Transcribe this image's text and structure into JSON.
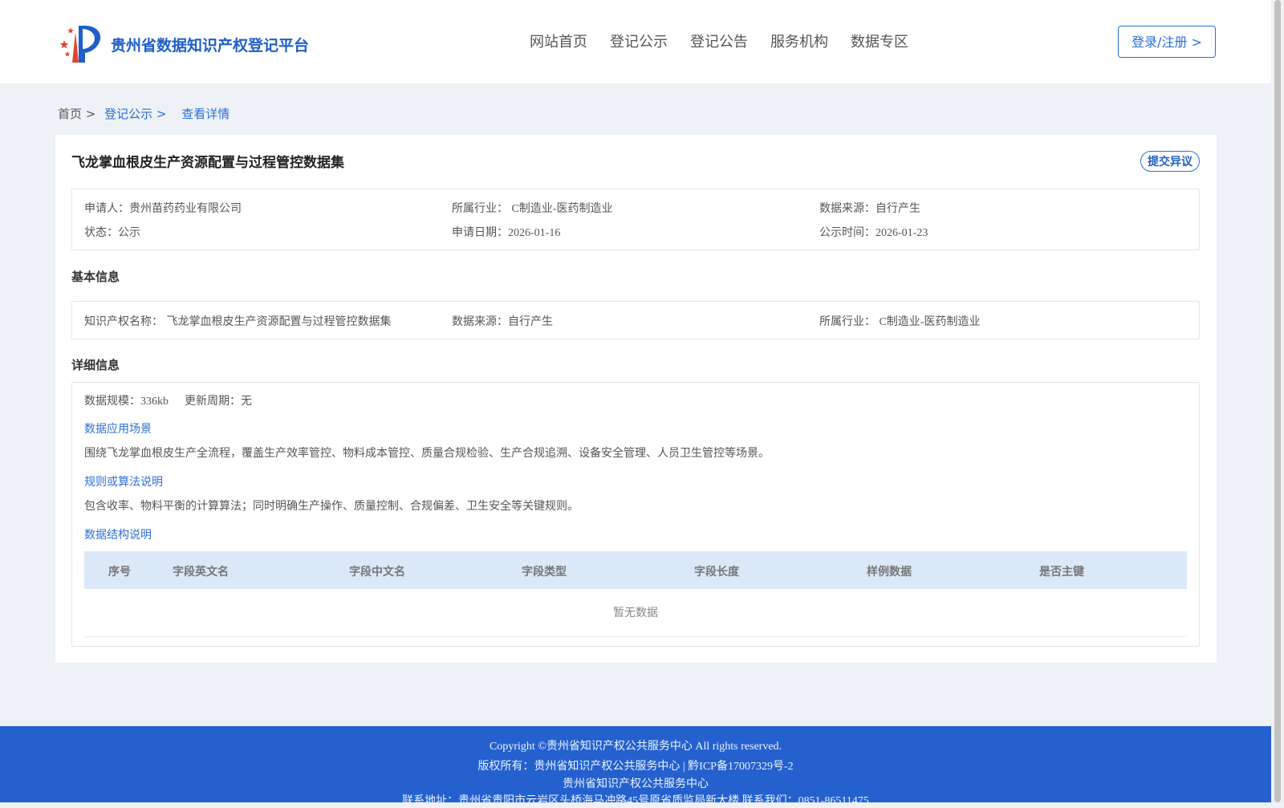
{
  "header": {
    "site_title": "贵州省数据知识产权登记平台",
    "nav": [
      "网站首页",
      "登记公示",
      "登记公告",
      "服务机构",
      "数据专区"
    ],
    "login_label": "登录/注册 >"
  },
  "breadcrumb": {
    "items": [
      "首页 >",
      "登记公示 >",
      "查看详情"
    ]
  },
  "detail": {
    "title": "飞龙掌血根皮生产资源配置与过程管控数据集",
    "objection_label": "提交异议",
    "summary": {
      "applicant_label": "申请人：",
      "applicant": "贵州苗药药业有限公司",
      "industry_label": "所属行业：",
      "industry": "C制造业-医药制造业",
      "source_label": "数据来源：",
      "source": "自行产生",
      "status_label": "状态：",
      "status": "公示",
      "apply_date_label": "申请日期：",
      "apply_date": "2026-01-16",
      "publicity_time_label": "公示时间：",
      "publicity_time": "2026-01-23"
    },
    "basic": {
      "heading": "基本信息",
      "ip_name_label": "知识产权名称：",
      "ip_name": "飞龙掌血根皮生产资源配置与过程管控数据集",
      "source_label": "数据来源：",
      "source": "自行产生",
      "industry_label": "所属行业：",
      "industry": "C制造业-医药制造业"
    },
    "detailed": {
      "heading": "详细信息",
      "scale_label": "数据规模：",
      "scale": "336kb",
      "cycle_label": "更新周期：",
      "cycle": "无",
      "scenario_heading": "数据应用场景",
      "scenario_text": "围绕飞龙掌血根皮生产全流程，覆盖生产效率管控、物料成本管控、质量合规检验、生产合规追溯、设备安全管理、人员卫生管控等场景。",
      "rules_heading": "规则或算法说明",
      "rules_text": "包含收率、物料平衡的计算算法；同时明确生产操作、质量控制、合规偏差、卫生安全等关键规则。",
      "structure_heading": "数据结构说明",
      "table_headers": [
        "序号",
        "字段英文名",
        "字段中文名",
        "字段类型",
        "字段长度",
        "样例数据",
        "是否主键"
      ],
      "empty_text": "暂无数据"
    }
  },
  "footer": {
    "copyright": "Copyright ©贵州省知识产权公共服务中心 All rights reserved.",
    "owner": "版权所有：贵州省知识产权公共服务中心 | 黔ICP备17007329号-2",
    "org": "贵州省知识产权公共服务中心",
    "contact": "联系地址：贵州省贵阳市云岩区头桥海马冲路45号原省质监局新大楼 联系我们：0851-86511475"
  },
  "colors": {
    "brand": "#1f5fc8",
    "footer_bg": "#2461cf",
    "page_bg": "#eef2f6",
    "table_head_bg": "#dbe8f8"
  }
}
